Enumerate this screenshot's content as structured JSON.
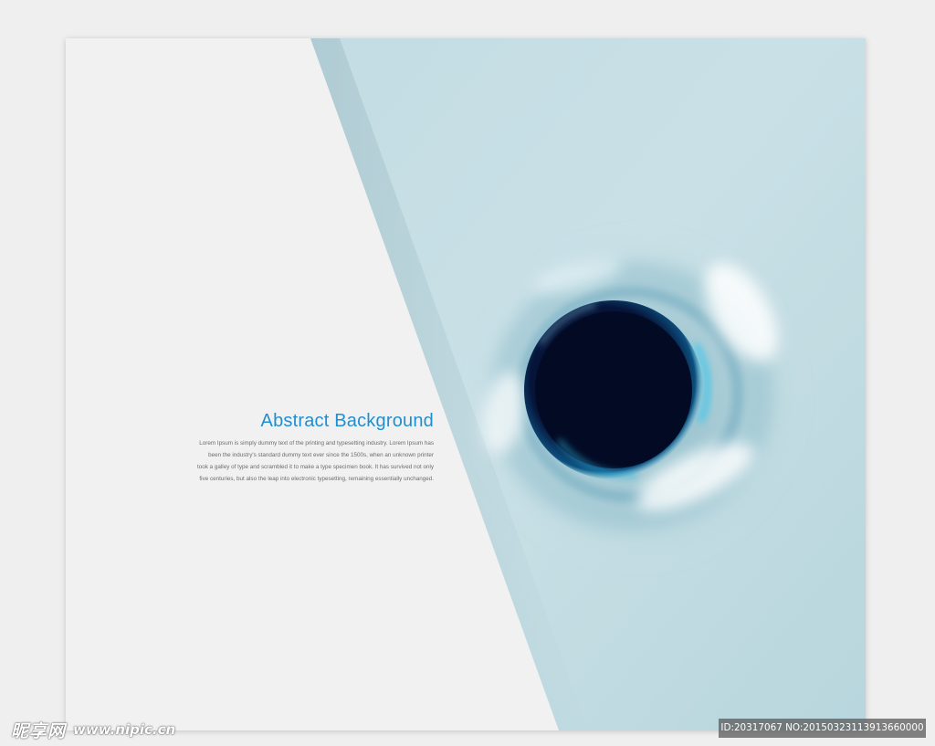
{
  "content": {
    "headline": "Abstract Background",
    "body_lines": [
      "Lorem Ipsum is simply dummy text of the printing and typesetting industry. Lorem Ipsum has",
      "been the industry's standard dummy text ever since the 1500s, when an unknown printer",
      "took a galley of type and scrambled it to make a type specimen book. It has survived not only",
      "five centuries, but also the leap into electronic typesetting, remaining essentially unchanged."
    ]
  },
  "watermark": {
    "logo_text": "昵享网",
    "url": "www.nipic.cn",
    "id_text": "ID:20317067 NO:20150323113913660000"
  },
  "colors": {
    "page_background": "#efefef",
    "card_background": "#f1f1f1",
    "panel_blue": "#bcd8de",
    "headline_blue": "#1f8fd2",
    "body_gray": "#6d6d6d",
    "vortex_core": "#030a24"
  }
}
